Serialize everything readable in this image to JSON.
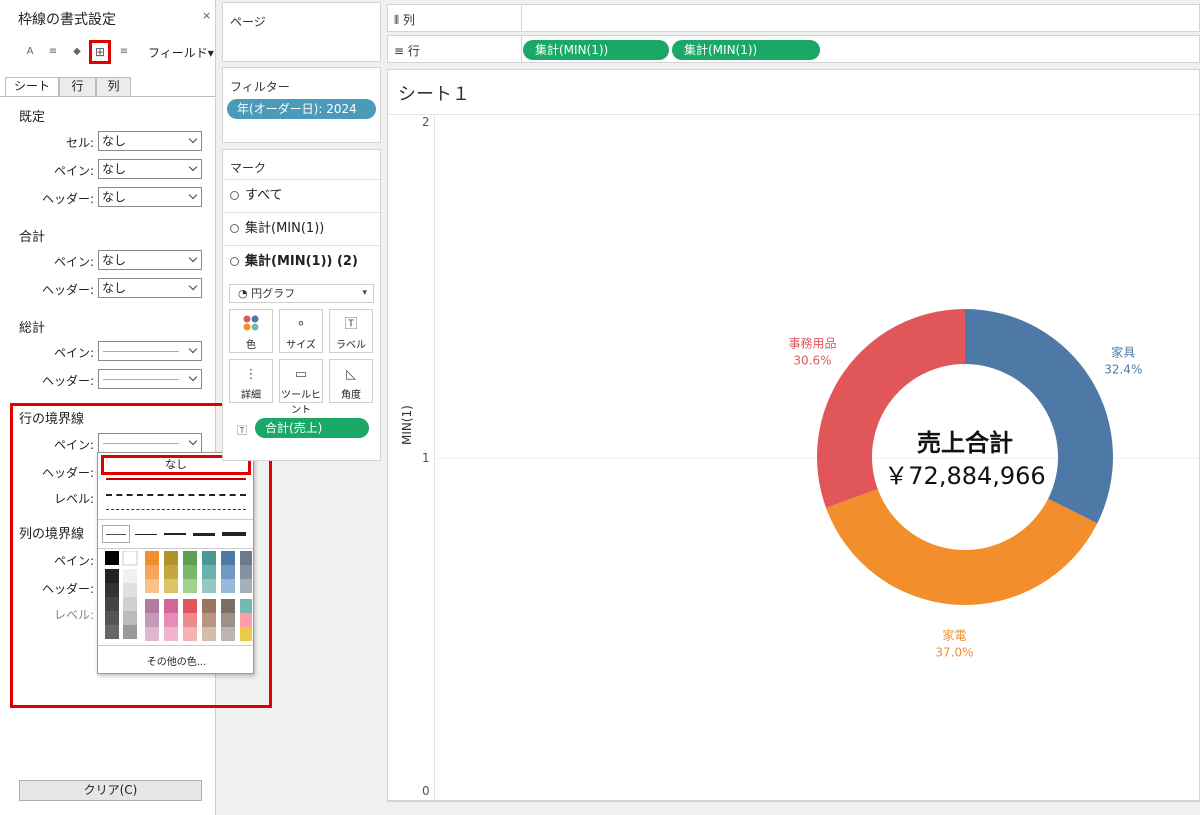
{
  "format_pane": {
    "title": "枠線の書式設定",
    "close": "×",
    "field_dropdown": "フィールド▾",
    "tools": [
      "A",
      "≡",
      "◆",
      "⊞",
      "≡"
    ],
    "tabs": [
      "シート",
      "行",
      "列"
    ],
    "sections": {
      "default": {
        "title": "既定",
        "cell_label": "セル:",
        "cell_value": "なし",
        "pane_label": "ペイン:",
        "pane_value": "なし",
        "header_label": "ヘッダー:",
        "header_value": "なし"
      },
      "total": {
        "title": "合計",
        "pane_label": "ペイン:",
        "pane_value": "なし",
        "header_label": "ヘッダー:",
        "header_value": "なし"
      },
      "grand_total": {
        "title": "総計",
        "pane_label": "ペイン:",
        "header_label": "ヘッダー:"
      },
      "row_divider": {
        "title": "行の境界線",
        "pane_label": "ペイン:",
        "header_label": "ヘッダー:",
        "level_label": "レベル:"
      },
      "col_divider": {
        "title": "列の境界線",
        "pane_label": "ペイン:",
        "header_label": "ヘッダー:",
        "level_label": "レベル:"
      }
    },
    "popup": {
      "none_option": "なし",
      "more_colors": "その他の色..."
    },
    "clear_button": "クリア(C)"
  },
  "cards": {
    "pages": "ページ",
    "filters_title": "フィルター",
    "filter_pill": "年(オーダー日): 2024",
    "marks_title": "マーク",
    "marks_rows": [
      "すべて",
      "集計(MIN(1))",
      "集計(MIN(1)) (2)"
    ],
    "mark_type": "円グラフ",
    "buttons": [
      "色",
      "サイズ",
      "ラベル",
      "詳細",
      "ツールヒント",
      "角度"
    ],
    "label_pill": "合計(売上)"
  },
  "shelves": {
    "columns_label": "列",
    "rows_label": "行",
    "row_pills": [
      "集計(MIN(1))",
      "集計(MIN(1))"
    ]
  },
  "viz": {
    "title": "シート１",
    "y_axis_label": "MIN(1)",
    "y_ticks": [
      "2",
      "1",
      "0"
    ],
    "center_title": "売上合計",
    "center_value": "￥72,884,966"
  },
  "chart_data": {
    "type": "pie",
    "donut": true,
    "slices": [
      {
        "label": "家具",
        "value": 32.4,
        "percent_label": "32.4%",
        "color": "#4e79a7"
      },
      {
        "label": "家電",
        "value": 37.0,
        "percent_label": "37.0%",
        "color": "#f28e2b"
      },
      {
        "label": "事務用品",
        "value": 30.6,
        "percent_label": "30.6%",
        "color": "#e15759"
      }
    ]
  },
  "colors": {
    "accent_red": "#e00000",
    "filter_pill": "#4b9ab9",
    "green_pill": "#1aa866"
  }
}
